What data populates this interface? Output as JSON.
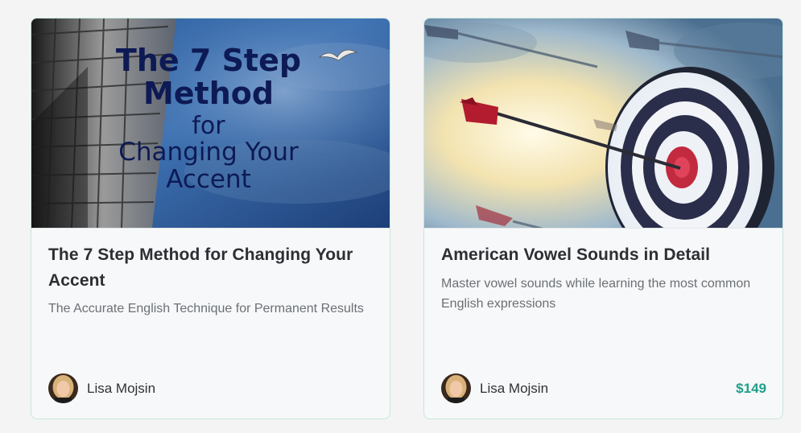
{
  "courses": [
    {
      "thumbnail_text": {
        "line1": "The 7 Step",
        "line2": "Method",
        "line3": "for",
        "line4": "Changing Your",
        "line5": "Accent"
      },
      "title": "The 7 Step Method for Changing Your Accent",
      "subtitle": "The Accurate English Technique for Permanent Results",
      "author": "Lisa Mojsin",
      "price": ""
    },
    {
      "title": "American Vowel Sounds in Detail",
      "subtitle": "Master vowel sounds while learning the most common English expressions",
      "author": "Lisa Mojsin",
      "price": "$149"
    }
  ],
  "colors": {
    "card_border": "#c8e6e1",
    "price": "#1f9f8b",
    "title": "#2c2f33",
    "subtitle": "#6b7075",
    "thumb_text": "#0d1a55"
  }
}
